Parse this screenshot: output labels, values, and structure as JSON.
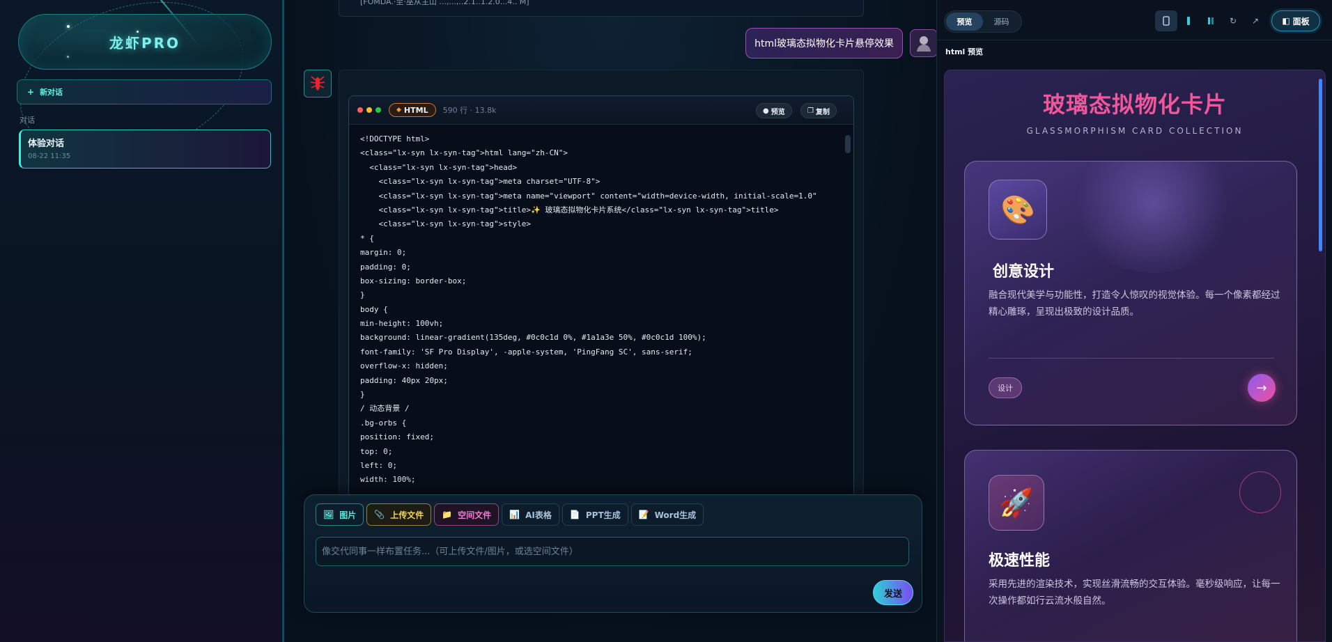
{
  "sidebar": {
    "logo": "龙虾PRO",
    "new_chat": "新对话",
    "new_chat_icon": "+",
    "section_label": "对话",
    "chats": [
      {
        "title": "体验对话",
        "time": "08-22 11:35"
      }
    ]
  },
  "main": {
    "top_card_text": "[FOMDA.·至·巫从主山 ...,...,..2.1..1.2.0...4.. M]",
    "user_message": "html玻璃态拟物化卡片悬停效果",
    "code": {
      "language": "HTML",
      "meta": "590 行 · 13.8k",
      "preview_btn": "预览",
      "copy_btn": "复制",
      "lines": [
        "<!DOCTYPE html>",
        "<class=\"lx-syn lx-syn-tag\">html lang=\"zh-CN\">",
        "  <class=\"lx-syn lx-syn-tag\">head>",
        "    <class=\"lx-syn lx-syn-tag\">meta charset=\"UTF-8\">",
        "    <class=\"lx-syn lx-syn-tag\">meta name=\"viewport\" content=\"width=device-width, initial-scale=1.0\"",
        "    <class=\"lx-syn lx-syn-tag\">title>✨ 玻璃态拟物化卡片系统</class=\"lx-syn lx-syn-tag\">title>",
        "    <class=\"lx-syn lx-syn-tag\">style>",
        "* {",
        "margin: 0;",
        "padding: 0;",
        "box-sizing: border-box;",
        "}",
        "body {",
        "min-height: 100vh;",
        "background: linear-gradient(135deg, #0c0c1d 0%, #1a1a3e 50%, #0c0c1d 100%);",
        "font-family: 'SF Pro Display', -apple-system, 'PingFang SC', sans-serif;",
        "overflow-x: hidden;",
        "padding: 40px 20px;",
        "}",
        "/ 动态背景 /",
        ".bg-orbs {",
        "position: fixed;",
        "top: 0;",
        "left: 0;",
        "width: 100%;"
      ]
    }
  },
  "composer": {
    "tools": [
      {
        "icon": "🖼",
        "label": "图片",
        "key": "image"
      },
      {
        "icon": "📎",
        "label": "上传文件",
        "key": "upload"
      },
      {
        "icon": "📁",
        "label": "空间文件",
        "key": "space"
      },
      {
        "icon": "📊",
        "label": "AI表格",
        "key": "table"
      },
      {
        "icon": "📄",
        "label": "PPT生成",
        "key": "ppt"
      },
      {
        "icon": "📝",
        "label": "Word生成",
        "key": "word"
      }
    ],
    "placeholder": "像交代同事一样布置任务...（可上传文件/图片，或选空间文件）",
    "send": "发送"
  },
  "panel": {
    "tab_preview": "预览",
    "tab_source": "源码",
    "panel_btn": "面板",
    "label": "html 预览",
    "page": {
      "title": "玻璃态拟物化卡片",
      "subtitle": "GLASSMORPHISM CARD COLLECTION",
      "cards": [
        {
          "icon": "🎨",
          "title": "创意设计",
          "desc": "融合现代美学与功能性，打造令人惊叹的视觉体验。每一个像素都经过精心雕琢，呈现出极致的设计品质。",
          "tag": "设计",
          "arrow": "→"
        },
        {
          "icon": "🚀",
          "title": "极速性能",
          "desc": "采用先进的渲染技术，实现丝滑流畅的交互体验。毫秒级响应，让每一次操作都如行云流水般自然。"
        }
      ]
    }
  },
  "colors": {
    "accent_cyan": "#33f0e4",
    "accent_pink": "#f0579a",
    "send_gradient_start": "#2ed0d8",
    "send_gradient_end": "#7a4cf0"
  }
}
